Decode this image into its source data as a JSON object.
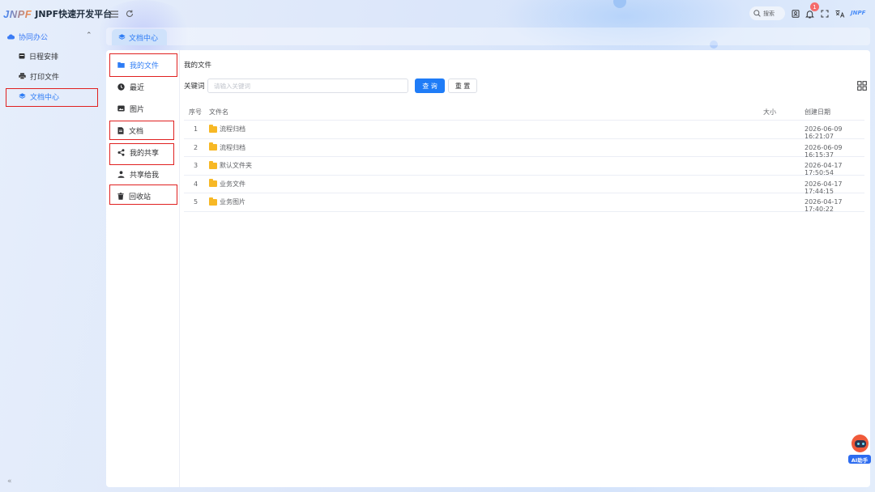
{
  "app": {
    "title": "JNPF快速开发平台",
    "logo_mark": "JNPF"
  },
  "header": {
    "search_label": "搜索",
    "notification_count": "1",
    "mini_logo": "JNPF"
  },
  "sidebar": {
    "group_label": "协同办公",
    "items": [
      {
        "label": "日程安排"
      },
      {
        "label": "打印文件"
      },
      {
        "label": "文档中心"
      }
    ]
  },
  "tabs": [
    {
      "label": "文档中心"
    }
  ],
  "file_nav": {
    "items": [
      {
        "label": "我的文件"
      },
      {
        "label": "最近"
      },
      {
        "label": "图片"
      },
      {
        "label": "文档"
      },
      {
        "label": "我的共享"
      },
      {
        "label": "共享给我"
      },
      {
        "label": "回收站"
      }
    ]
  },
  "main": {
    "breadcrumb": "我的文件",
    "keyword_label": "关键词",
    "keyword_placeholder": "请输入关键词",
    "keyword_value": "",
    "query_button": "查 询",
    "reset_button": "重 置"
  },
  "table": {
    "columns": [
      "序号",
      "文件名",
      "大小",
      "创建日期"
    ],
    "rows": [
      {
        "index": "1",
        "name": "流程归档",
        "size": "",
        "date": "2026-06-09 16:21:07"
      },
      {
        "index": "2",
        "name": "流程归档",
        "size": "",
        "date": "2026-06-09 16:15:37"
      },
      {
        "index": "3",
        "name": "默认文件夹",
        "size": "",
        "date": "2026-04-17 17:50:54"
      },
      {
        "index": "4",
        "name": "业务文件",
        "size": "",
        "date": "2026-04-17 17:44:15"
      },
      {
        "index": "5",
        "name": "业务图片",
        "size": "",
        "date": "2026-04-17 17:40:22"
      }
    ]
  },
  "ai": {
    "label": "AI助手"
  },
  "colors": {
    "accent": "#1f7cf7",
    "annotation": "#e02020",
    "folder": "#f7b825"
  }
}
